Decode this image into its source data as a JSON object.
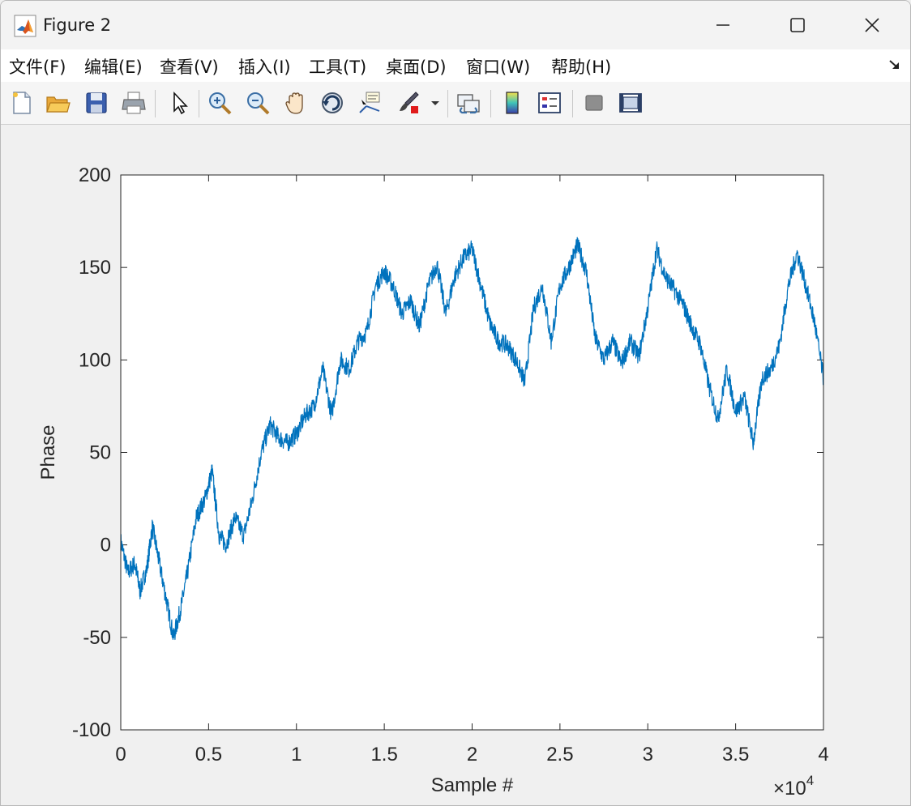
{
  "window": {
    "title": "Figure 2",
    "controls": {
      "minimize": "minimize-icon",
      "maximize": "maximize-icon",
      "close": "close-icon"
    }
  },
  "menu": {
    "items": [
      {
        "label": "文件(F)",
        "key": "F"
      },
      {
        "label": "编辑(E)",
        "key": "E"
      },
      {
        "label": "查看(V)",
        "key": "V"
      },
      {
        "label": "插入(I)",
        "key": "I"
      },
      {
        "label": "工具(T)",
        "key": "T"
      },
      {
        "label": "桌面(D)",
        "key": "D"
      },
      {
        "label": "窗口(W)",
        "key": "W"
      },
      {
        "label": "帮助(H)",
        "key": "H"
      }
    ]
  },
  "toolbar": {
    "icons": [
      "new-figure-icon",
      "open-folder-icon",
      "save-icon",
      "print-icon",
      "select-pointer-icon",
      "zoom-in-icon",
      "zoom-out-icon",
      "pan-hand-icon",
      "rotate-3d-icon",
      "data-cursor-icon",
      "brush-icon",
      "brush-dropdown-icon",
      "link-plot-icon",
      "colorbar-icon",
      "legend-icon",
      "hide-plot-tools-icon",
      "show-plot-tools-icon"
    ]
  },
  "colors": {
    "line": "#0072bd",
    "axis": "#262626",
    "plot_bg": "#ffffff",
    "figure_bg": "#f0f0f0"
  },
  "chart_data": {
    "type": "line",
    "title": "",
    "xlabel": "Sample #",
    "ylabel": "Phase",
    "xlim": [
      0,
      40000
    ],
    "ylim": [
      -100,
      200
    ],
    "x_tick_values": [
      0,
      5000,
      10000,
      15000,
      20000,
      25000,
      30000,
      35000,
      40000
    ],
    "x_tick_labels": [
      "0",
      "0.5",
      "1",
      "1.5",
      "2",
      "2.5",
      "3",
      "3.5",
      "4"
    ],
    "x_exponent_label": "×10",
    "x_exponent_power": "4",
    "y_tick_values": [
      -100,
      -50,
      0,
      50,
      100,
      150,
      200
    ],
    "y_tick_labels": [
      "-100",
      "-50",
      "0",
      "50",
      "100",
      "150",
      "200"
    ],
    "grid": false,
    "series": [
      {
        "x": [
          0,
          400,
          800,
          1100,
          1500,
          1800,
          2200,
          2600,
          3000,
          3400,
          3800,
          4300,
          4800,
          5200,
          5600,
          6000,
          6500,
          7000,
          7500,
          8000,
          8500,
          9000,
          9500,
          10000,
          10500,
          11000,
          11500,
          12000,
          12500,
          13000,
          13500,
          14000,
          14500,
          15000,
          15500,
          16000,
          16500,
          17000,
          17500,
          18000,
          18500,
          19000,
          19500,
          20000,
          20500,
          21000,
          21500,
          22000,
          22500,
          23000,
          23500,
          24000,
          24500,
          25000,
          25500,
          26000,
          26500,
          27000,
          27500,
          28000,
          28500,
          29000,
          29500,
          30000,
          30500,
          31000,
          31500,
          32000,
          32500,
          33000,
          33500,
          34000,
          34500,
          35000,
          35500,
          36000,
          36500,
          37000,
          37500,
          38000,
          38500,
          39000,
          39500,
          40000
        ],
        "y": [
          2,
          -15,
          -10,
          -25,
          -12,
          10,
          -10,
          -30,
          -50,
          -35,
          -15,
          15,
          25,
          40,
          5,
          0,
          15,
          5,
          25,
          50,
          65,
          58,
          55,
          60,
          70,
          75,
          95,
          70,
          100,
          95,
          110,
          115,
          140,
          148,
          140,
          125,
          132,
          118,
          140,
          152,
          125,
          145,
          155,
          160,
          140,
          120,
          110,
          108,
          100,
          88,
          128,
          140,
          110,
          140,
          150,
          162,
          148,
          112,
          100,
          110,
          98,
          110,
          102,
          128,
          160,
          145,
          138,
          130,
          118,
          108,
          85,
          68,
          95,
          72,
          80,
          55,
          90,
          95,
          108,
          140,
          158,
          140,
          120,
          90
        ]
      }
    ]
  }
}
